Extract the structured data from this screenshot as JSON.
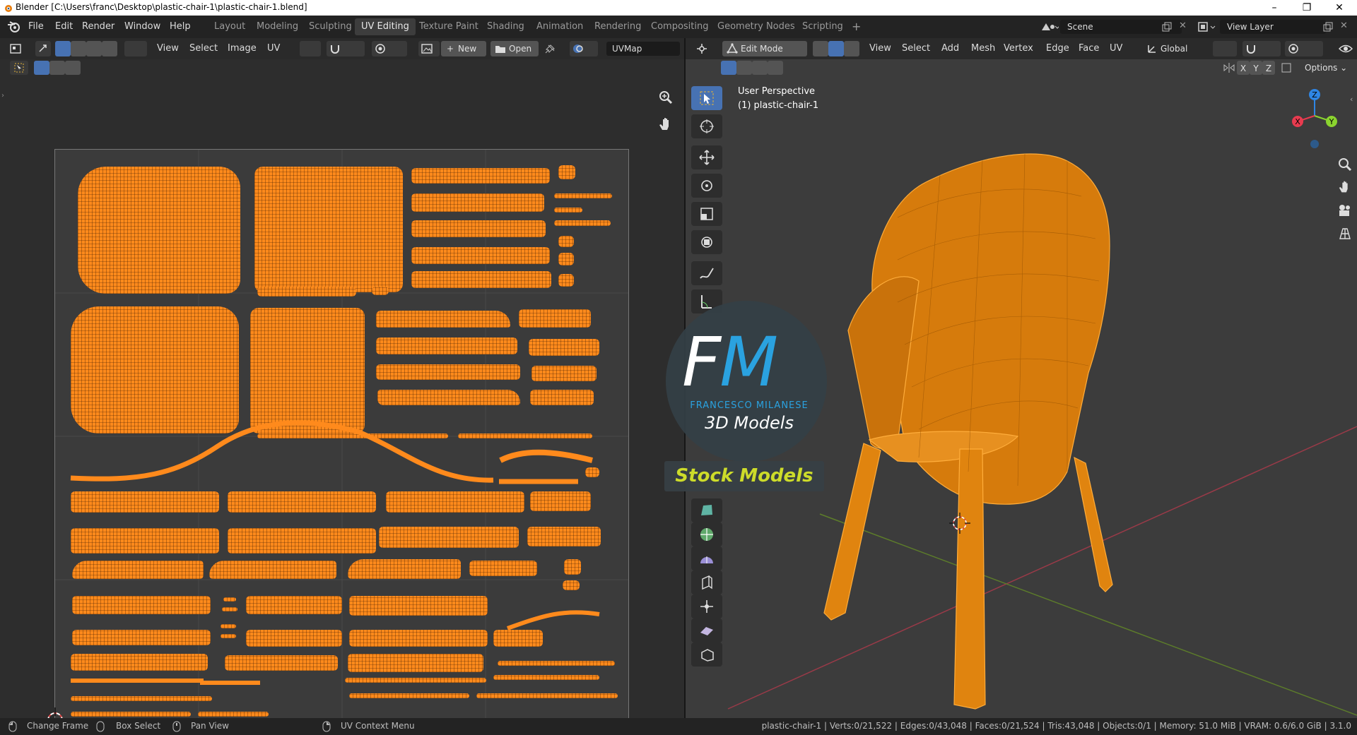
{
  "window": {
    "title": "Blender [C:\\Users\\franc\\Desktop\\plastic-chair-1\\plastic-chair-1.blend]",
    "controls": [
      "–",
      "❐",
      "✕"
    ]
  },
  "menus": [
    "File",
    "Edit",
    "Render",
    "Window",
    "Help"
  ],
  "workspaces": {
    "tabs": [
      "Layout",
      "Modeling",
      "Sculpting",
      "UV Editing",
      "Texture Paint",
      "Shading",
      "Animation",
      "Rendering",
      "Compositing",
      "Geometry Nodes",
      "Scripting"
    ],
    "active": "UV Editing",
    "add_symbol": "+"
  },
  "scene": {
    "name": "Scene",
    "view_layer": "View Layer"
  },
  "uv_editor": {
    "menus": [
      "View",
      "Select",
      "Image",
      "UV"
    ],
    "new_label": "New",
    "open_label": "Open",
    "uvmap": "UVMap"
  },
  "viewport": {
    "mode": "Edit Mode",
    "menus": [
      "View",
      "Select",
      "Add",
      "Mesh",
      "Vertex",
      "Edge",
      "Face",
      "UV"
    ],
    "orientation": "Global",
    "axes": [
      "X",
      "Y",
      "Z"
    ],
    "options_label": "Options",
    "perspective": "User Perspective",
    "object_label": "(1) plastic-chair-1",
    "gizmo": {
      "x_color": "#e83b4f",
      "y_color": "#8bd42f",
      "z_color": "#2f86e4"
    }
  },
  "watermark": {
    "logo_f": "F",
    "logo_m": "M",
    "name": "FRANCESCO MILANESE",
    "subtitle": "3D Models",
    "banner": "Stock Models"
  },
  "status_bar": {
    "hints": [
      "Change Frame",
      "Box Select",
      "Pan View",
      "UV Context Menu"
    ],
    "stats": "plastic-chair-1 | Verts:0/21,522 | Edges:0/43,048 | Faces:0/21,524 | Tris:43,048 | Objects:0/1 | Memory: 51.0 MiB | VRAM: 0.6/6.0 GiB | 3.1.0"
  },
  "colors": {
    "accent": "#4772b3",
    "uv_island": "#ff8a1c",
    "mesh": "#ff8a1c"
  }
}
